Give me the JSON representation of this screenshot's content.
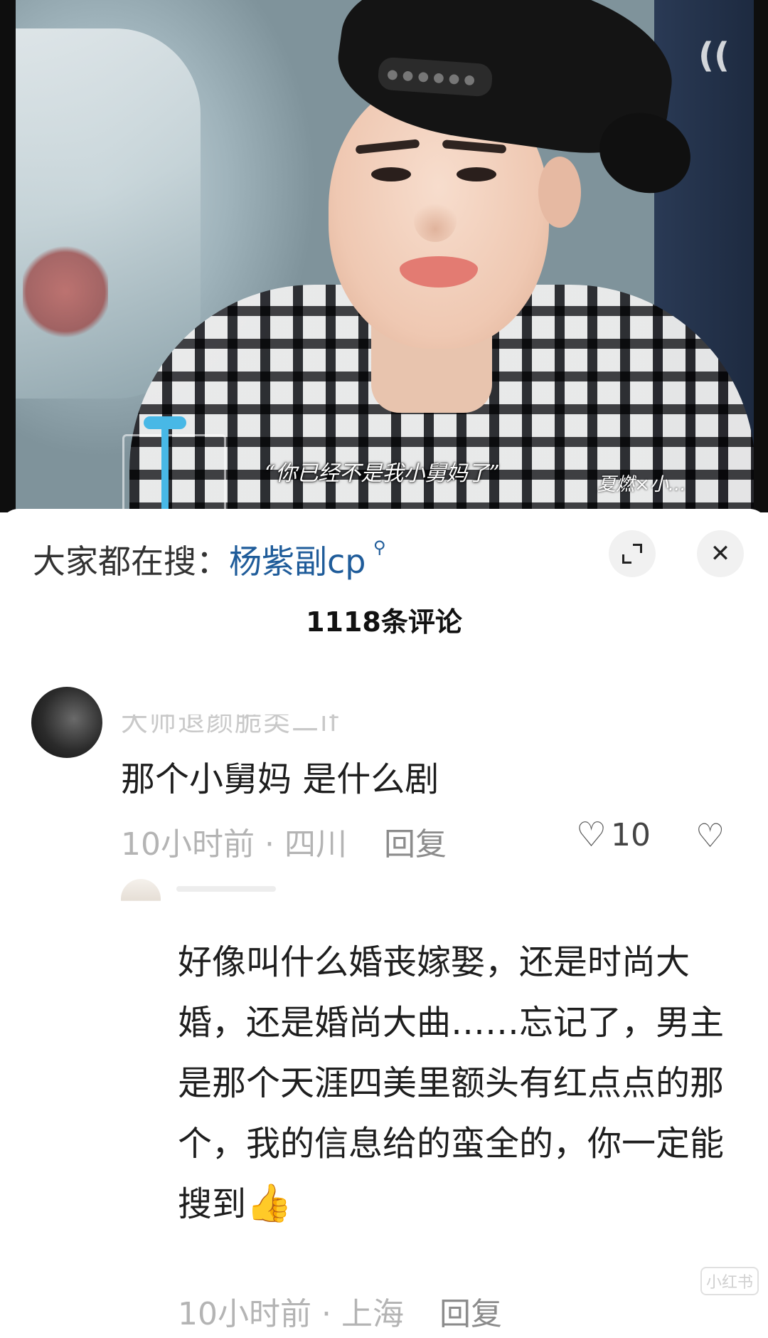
{
  "video": {
    "subtitle": "“你已经不是我小舅妈了”",
    "watermark": "夏燃×小..."
  },
  "search": {
    "prefix": "大家都在搜：",
    "term": "杨紫副cp",
    "icon": "search-icon"
  },
  "header": {
    "comment_count": "1118条评论",
    "close_label": "✕"
  },
  "comments": [
    {
      "username": "大师退颜脆类二if",
      "text": "那个小舅妈 是什么剧",
      "meta": "10小时前 · 四川",
      "reply_label": "回复",
      "likes": "10"
    },
    {
      "username": "",
      "text": "好像叫什么婚丧嫁娶，还是时尚大婚，还是婚尚大曲……忘记了，男主是那个天涯四美里额头有红点点的那个，我的信息给的蛮全的，你一定能搜到",
      "emoji": "👍",
      "meta": "10小时前 · 上海",
      "reply_label": "回复"
    }
  ],
  "app_mark": "小红书"
}
